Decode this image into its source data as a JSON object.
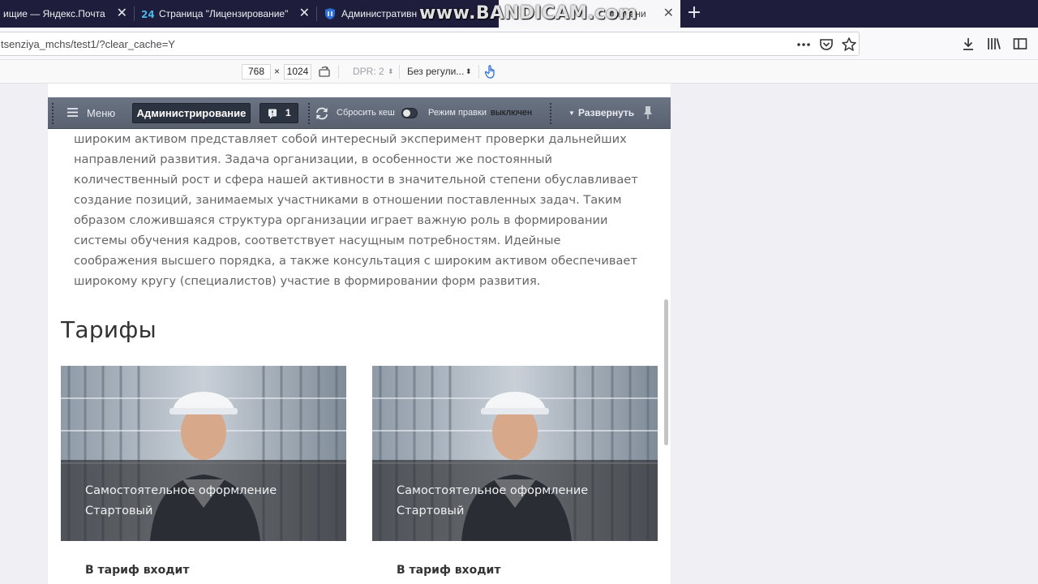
{
  "browser": {
    "tabs": [
      {
        "label": "ищие — Яндекс.Почта",
        "active": false
      },
      {
        "label": "Страница \"Лицензирование\"",
        "active": false
      },
      {
        "label": "Административн",
        "active": false
      },
      {
        "label": "молчани",
        "active": true
      }
    ],
    "new_tab_label": "+",
    "watermark": "www.BANDICAM.com",
    "url": "tsenziya_mchs/test1/?clear_cache=Y",
    "icons": [
      "more-icon",
      "pocket-icon",
      "bookmark-star-icon",
      "download-icon",
      "library-icon",
      "sidebar-icon"
    ]
  },
  "rdm": {
    "width": "768",
    "times": "×",
    "height": "1024",
    "dpr": "DPR: 2",
    "throttle": "Без регули..."
  },
  "admin_panel": {
    "menu_label": "Меню",
    "admin_label": "Администрирование",
    "notif_count": "1",
    "clear_cache_label": "Сбросить кеш",
    "edit_mode_label": "Режим правки",
    "edit_mode_state": "выключен",
    "expand_label": "Развернуть"
  },
  "article": {
    "lines": [
      "широким активом представляет собой интересный эксперимент проверки дальнейших",
      "направлений развития. Задача организации, в особенности же постоянный",
      "количественный рост и сфера нашей активности в значительной степени обуславливает",
      "создание позиций, занимаемых участниками в отношении поставленных задач. Таким",
      "образом сложившаяся структура организации играет важную роль в формировании",
      "системы обучения кадров, соответствует насущным потребностям. Идейные",
      "соображения высшего порядка, а также консультация с широким активом обеспечивает",
      "широкому кругу (специалистов) участие в формировании форм развития."
    ]
  },
  "tariffs": {
    "title": "Тарифы",
    "cards": [
      {
        "line1": "Самостоятельное оформление",
        "line2": "Стартовый",
        "included": "В тариф входит"
      },
      {
        "line1": "Самостоятельное оформление",
        "line2": "Стартовый",
        "included": "В тариф входит"
      }
    ]
  }
}
